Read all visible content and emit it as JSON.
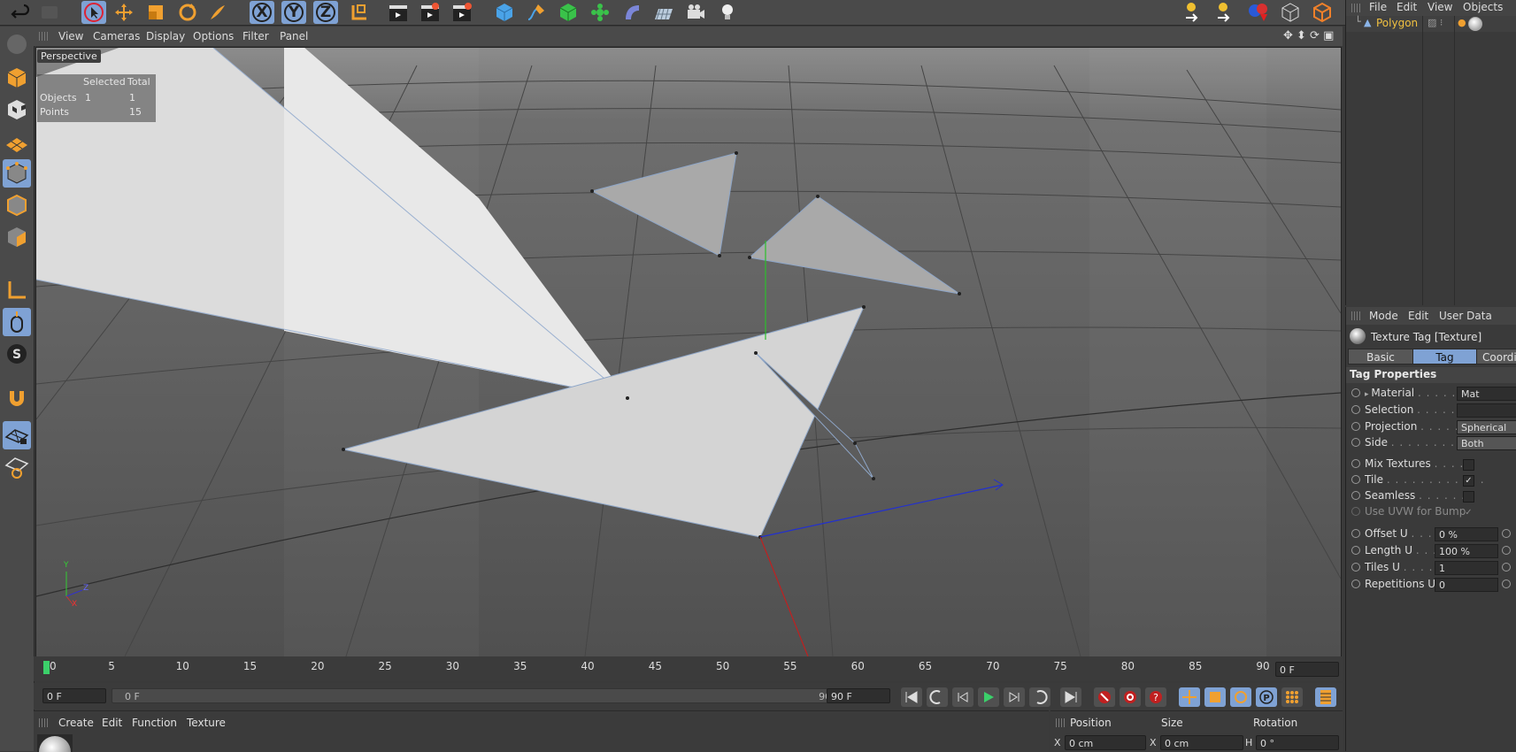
{
  "viewport": {
    "menu": [
      "View",
      "Cameras",
      "Display",
      "Options",
      "Filter",
      "Panel"
    ],
    "label": "Perspective",
    "hud": {
      "col_selected": "Selected",
      "col_total": "Total",
      "rows": [
        {
          "label": "Objects",
          "selected": "1",
          "total": "1"
        },
        {
          "label": "Points",
          "selected": "",
          "total": "15"
        }
      ]
    },
    "axis_letters": {
      "y": "Y",
      "z": "Z",
      "x": "X"
    }
  },
  "toolbar": {
    "axis_labels": [
      "X",
      "Y",
      "Z"
    ]
  },
  "timeline": {
    "ticks": [
      "0",
      "5",
      "10",
      "15",
      "20",
      "25",
      "30",
      "35",
      "40",
      "45",
      "50",
      "55",
      "60",
      "65",
      "70",
      "75",
      "80",
      "85",
      "90"
    ],
    "current_frame": "0 F"
  },
  "transport": {
    "start_field": "0 F",
    "range_start": "0 F",
    "range_end": "90 F",
    "end_field": "90 F"
  },
  "material_manager": {
    "menu": [
      "Create",
      "Edit",
      "Function",
      "Texture"
    ]
  },
  "coordinates": {
    "headers": [
      "Position",
      "Size",
      "Rotation"
    ],
    "row1": {
      "pos_axis": "X",
      "pos_val": "0 cm",
      "size_axis": "X",
      "size_val": "0 cm",
      "rot_axis": "H",
      "rot_val": "0 °"
    }
  },
  "object_manager": {
    "menu": [
      "File",
      "Edit",
      "View",
      "Objects"
    ],
    "object_name": "Polygon"
  },
  "attributes": {
    "menu": [
      "Mode",
      "Edit",
      "User Data"
    ],
    "title": "Texture Tag [Texture]",
    "tabs": [
      "Basic",
      "Tag",
      "Coordin"
    ],
    "section": "Tag Properties",
    "material": {
      "label": "Material",
      "dots": ". . . . . . .",
      "value": "Mat"
    },
    "selection": {
      "label": "Selection",
      "dots": ". . . . . . . .",
      "value": ""
    },
    "projection": {
      "label": "Projection",
      "dots": ". . . . . . .",
      "value": "Spherical"
    },
    "side": {
      "label": "Side",
      "dots": ". . . . . . . . . . . .",
      "value": "Both"
    },
    "mix": {
      "label": "Mix Textures",
      "dots": ". . . .",
      "checked": ""
    },
    "tile": {
      "label": "Tile",
      "dots": ". . . . . . . . . . . .",
      "checked": "✓"
    },
    "seamless": {
      "label": "Seamless",
      "dots": ". . . . . . .",
      "checked": ""
    },
    "uvw": {
      "label": "Use UVW for Bump",
      "checked": "✓"
    },
    "offset_u": {
      "label": "Offset U",
      "dots": ". . . . .",
      "value": "0 %"
    },
    "length_u": {
      "label": "Length U",
      "dots": ". . . .",
      "value": "100 %"
    },
    "tiles_u": {
      "label": "Tiles U",
      "dots": ". . . . . .",
      "value": "1"
    },
    "reps_u": {
      "label": "Repetitions U",
      "value": "0"
    }
  },
  "colors": {
    "accent": "#7fa2d4",
    "orange": "#f0a030",
    "panel": "#3a3a3a",
    "viewport": "#5a5a5a"
  }
}
